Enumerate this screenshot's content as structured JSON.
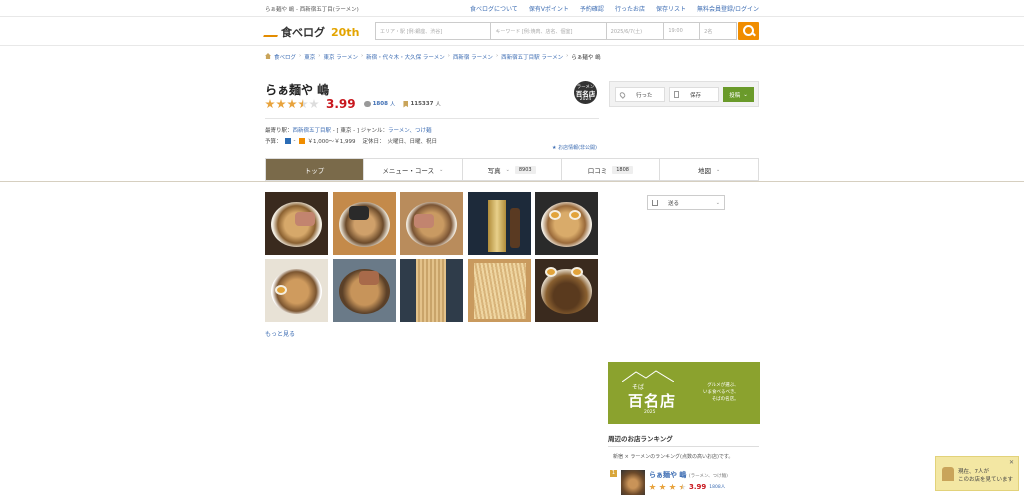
{
  "top": {
    "crumb": "らぁ麺や 嶋 - 西新宿五丁目(ラーメン)",
    "links": [
      "食べログについて",
      "保有Vポイント",
      "予約確認",
      "行ったお店",
      "保存リスト",
      "無料会員登録/ログイン"
    ]
  },
  "search": {
    "logo_text": "食べログ",
    "logo_badge": "20th",
    "area_placeholder": "エリア・駅 [例:銀座、渋谷]",
    "keyword_placeholder": "キーワード [例:焼肉、店名、個室]",
    "date": "2025/6/7(土)",
    "time": "19:00",
    "people": "2名"
  },
  "breadcrumb": {
    "items": [
      "食べログ",
      "東京",
      "東京 ラーメン",
      "新宿・代々木・大久保 ラーメン",
      "西新宿 ラーメン",
      "西新宿五丁目駅 ラーメン"
    ],
    "current": "らぁ麺や 嶋"
  },
  "shop": {
    "name": "らぁ麺や 嶋",
    "score": "3.99",
    "rating": 3.5,
    "reviews": "1808",
    "reviews_unit": "人",
    "saves": "115337",
    "saves_unit": "人",
    "badge_top": "ラーメン",
    "badge_main": "百名店",
    "badge_year": "2024",
    "station_label": "最寄り駅：",
    "station": "西新宿五丁目駅",
    "station_extra": " - [ 東京 - ]  ジャンル：",
    "genre": "ラーメン、つけ麺",
    "budget_label": "予算：",
    "budget_dinner": "-",
    "budget_lunch": "￥1,000～￥1,999",
    "holiday_label": "定休日：",
    "holiday": "火曜日、日曜、祝日",
    "coupon": "★ お店情報(非公開)"
  },
  "tabs": [
    {
      "label": "トップ",
      "num": "",
      "dd": ""
    },
    {
      "label": "メニュー・コース",
      "num": "",
      "dd": "⌄"
    },
    {
      "label": "写真",
      "num": "8903",
      "dd": "⌄"
    },
    {
      "label": "口コミ",
      "num": "1808",
      "dd": ""
    },
    {
      "label": "地図",
      "num": "",
      "dd": "⌄"
    }
  ],
  "sidebar": {
    "went": "行った",
    "save": "保存",
    "reserve": "投稿",
    "share": "送る",
    "banner": {
      "soba": "そば",
      "main": "百名店",
      "year": "2025",
      "copy1": "グルメが選ぶ、",
      "copy2": "いま食べるべき、",
      "copy3": "そばの名店。"
    },
    "ranking_title": "周辺のお店ランキング",
    "ranking_sub": "新宿 × ラーメンのランキング(点数の高いお店)です。",
    "ranking": {
      "num": "1",
      "name": "らぁ麺や 嶋",
      "genre": "(ラーメン、つけ麺)",
      "score": "3.99",
      "reviews": "1808人"
    }
  },
  "more_photos": "もっと見る",
  "toast": {
    "line1": "現在、7人が",
    "line2": "このお店を見ています"
  },
  "colors": {
    "accent": "#f08d00",
    "score": "#c8161d",
    "link": "#3d6db3",
    "tab_active": "#7a6a4a"
  }
}
